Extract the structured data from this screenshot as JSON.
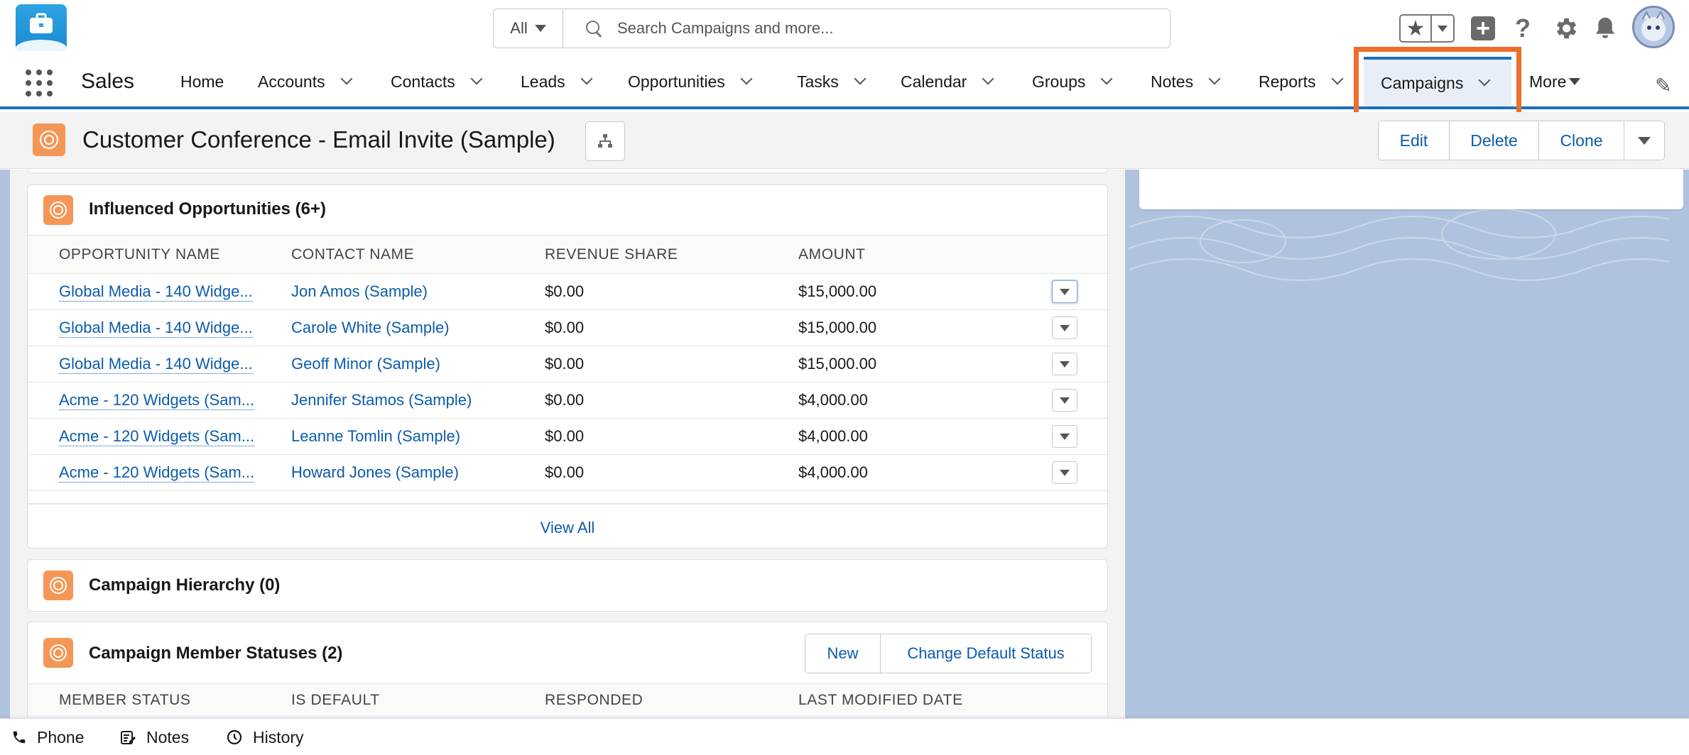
{
  "header": {
    "search_scope": "All",
    "search_placeholder": "Search Campaigns and more...",
    "icons": [
      "favorites-star-icon",
      "add-icon",
      "help-icon",
      "setup-gear-icon",
      "notifications-bell-icon",
      "user-avatar"
    ]
  },
  "nav": {
    "app_name": "Sales",
    "items": [
      {
        "label": "Home"
      },
      {
        "label": "Accounts"
      },
      {
        "label": "Contacts"
      },
      {
        "label": "Leads"
      },
      {
        "label": "Opportunities"
      },
      {
        "label": "Tasks"
      },
      {
        "label": "Calendar"
      },
      {
        "label": "Groups"
      },
      {
        "label": "Notes"
      },
      {
        "label": "Reports"
      },
      {
        "label": "Campaigns"
      }
    ],
    "more_label": "More",
    "active_item": "Campaigns",
    "highlight_color": "#ec6f2d"
  },
  "record": {
    "title": "Customer Conference - Email Invite (Sample)",
    "actions": [
      "Edit",
      "Delete",
      "Clone"
    ]
  },
  "influenced": {
    "title": "Influenced Opportunities (6+)",
    "columns": [
      "OPPORTUNITY NAME",
      "CONTACT NAME",
      "REVENUE SHARE",
      "AMOUNT"
    ],
    "rows": [
      {
        "opportunity": "Global Media - 140 Widge...",
        "contact": "Jon Amos (Sample)",
        "revenue_share": "$0.00",
        "amount": "$15,000.00"
      },
      {
        "opportunity": "Global Media - 140 Widge...",
        "contact": "Carole White (Sample)",
        "revenue_share": "$0.00",
        "amount": "$15,000.00"
      },
      {
        "opportunity": "Global Media - 140 Widge...",
        "contact": "Geoff Minor (Sample)",
        "revenue_share": "$0.00",
        "amount": "$15,000.00"
      },
      {
        "opportunity": "Acme - 120 Widgets (Sam...",
        "contact": "Jennifer Stamos (Sample)",
        "revenue_share": "$0.00",
        "amount": "$4,000.00"
      },
      {
        "opportunity": "Acme - 120 Widgets (Sam...",
        "contact": "Leanne Tomlin (Sample)",
        "revenue_share": "$0.00",
        "amount": "$4,000.00"
      },
      {
        "opportunity": "Acme - 120 Widgets (Sam...",
        "contact": "Howard Jones (Sample)",
        "revenue_share": "$0.00",
        "amount": "$4,000.00"
      }
    ],
    "view_all": "View All"
  },
  "hierarchy": {
    "title": "Campaign Hierarchy (0)"
  },
  "member_statuses": {
    "title": "Campaign Member Statuses (2)",
    "buttons": [
      "New",
      "Change Default Status"
    ],
    "columns": [
      "MEMBER STATUS",
      "IS DEFAULT",
      "RESPONDED",
      "LAST MODIFIED DATE"
    ]
  },
  "utility_bar": {
    "items": [
      {
        "label": "Phone",
        "icon": "phone-icon"
      },
      {
        "label": "Notes",
        "icon": "notes-icon"
      },
      {
        "label": "History",
        "icon": "history-clock-icon"
      }
    ]
  },
  "colors": {
    "brand_blue": "#1b6ec2",
    "link_blue": "#0b5cab",
    "campaign_orange": "#f49756",
    "background_blue": "#b0c3de"
  }
}
